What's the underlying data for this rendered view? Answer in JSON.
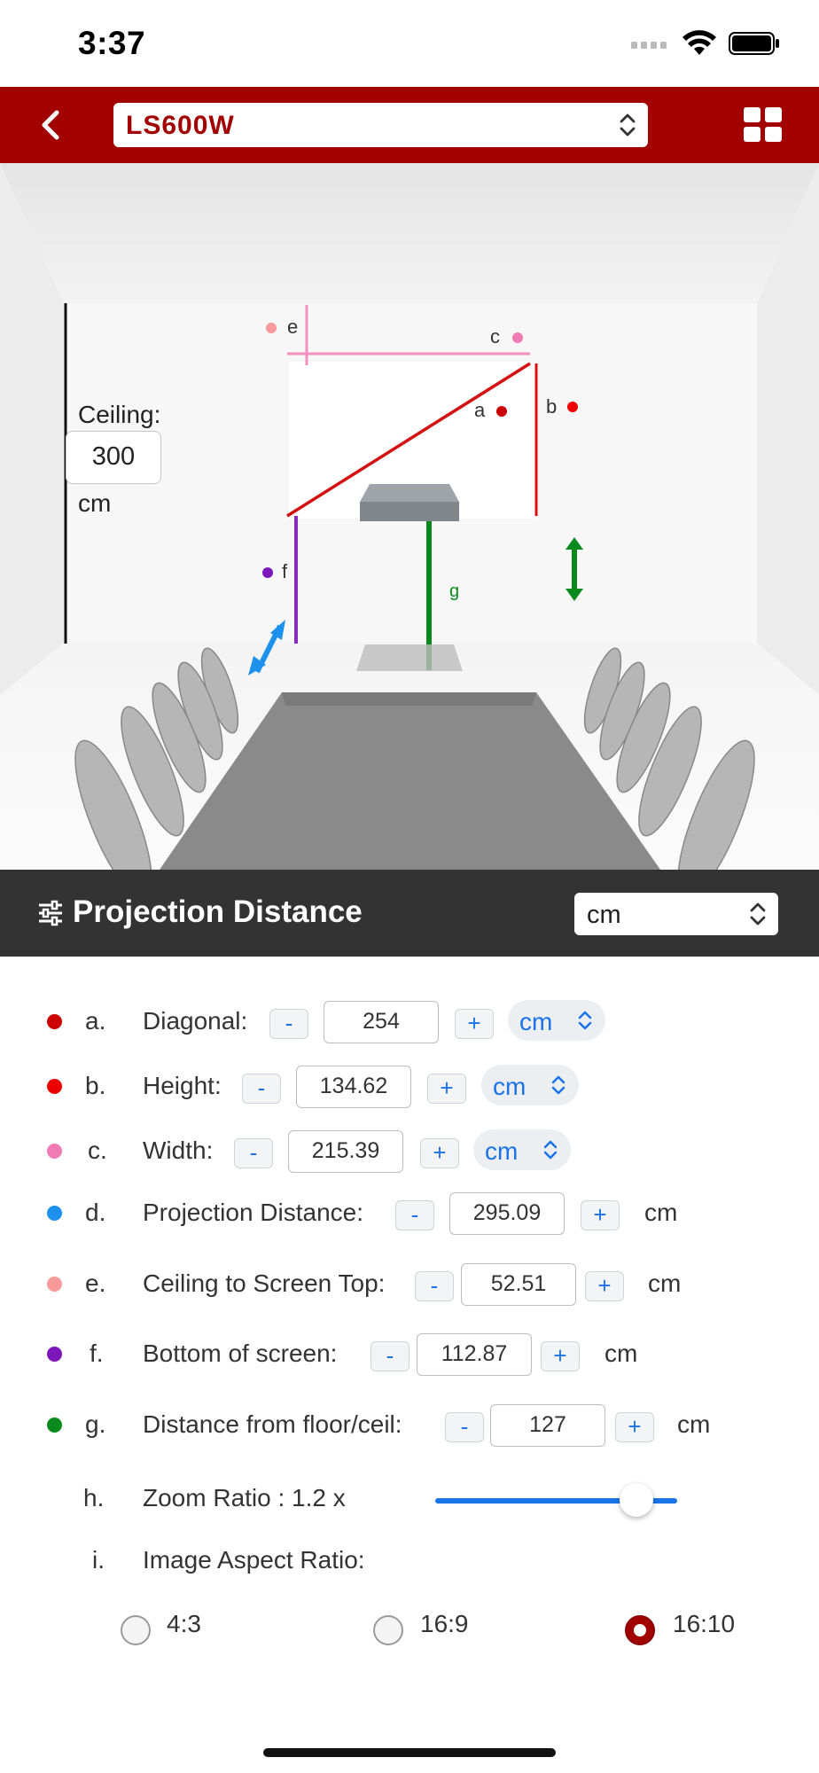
{
  "status_bar": {
    "time": "3:37"
  },
  "header": {
    "model": "LS600W"
  },
  "scene": {
    "ceiling_label": "Ceiling:",
    "ceiling_value": "300",
    "ceiling_unit": "cm",
    "marker_letters": {
      "a": "a",
      "b": "b",
      "c": "c",
      "e": "e",
      "f": "f",
      "g": "g"
    }
  },
  "section": {
    "title": "Projection Distance",
    "unit": "cm"
  },
  "rows": [
    {
      "letter": "a.",
      "label": "Diagonal:",
      "value": "254",
      "unit": "cm",
      "color": "#cc0000",
      "minus": "-",
      "plus": "+"
    },
    {
      "letter": "b.",
      "label": "Height:",
      "value": "134.62",
      "unit": "cm",
      "color": "#ee0000",
      "minus": "-",
      "plus": "+"
    },
    {
      "letter": "c.",
      "label": "Width:",
      "value": "215.39",
      "unit": "cm",
      "color": "#f07ab3",
      "minus": "-",
      "plus": "+"
    },
    {
      "letter": "d.",
      "label": "Projection Distance:",
      "value": "295.09",
      "unit": "cm",
      "color": "#1e90ee",
      "minus": "-",
      "plus": "+"
    },
    {
      "letter": "e.",
      "label": "Ceiling to Screen Top:",
      "value": "52.51",
      "unit": "cm",
      "color": "#f89a9a",
      "minus": "-",
      "plus": "+"
    },
    {
      "letter": "f.",
      "label": "Bottom of screen:",
      "value": "112.87",
      "unit": "cm",
      "color": "#7b16b8",
      "minus": "-",
      "plus": "+"
    },
    {
      "letter": "g.",
      "label": "Distance from floor/ceil:",
      "value": "127",
      "unit": "cm",
      "color": "#0a8a1c",
      "minus": "-",
      "plus": "+"
    }
  ],
  "zoom": {
    "letter": "h.",
    "label": "Zoom Ratio : 1.2 x",
    "level_fraction": 0.83
  },
  "aspect": {
    "letter": "i.",
    "label": "Image Aspect Ratio:",
    "options": [
      "4:3",
      "16:9",
      "16:10"
    ],
    "selected": "16:10"
  }
}
